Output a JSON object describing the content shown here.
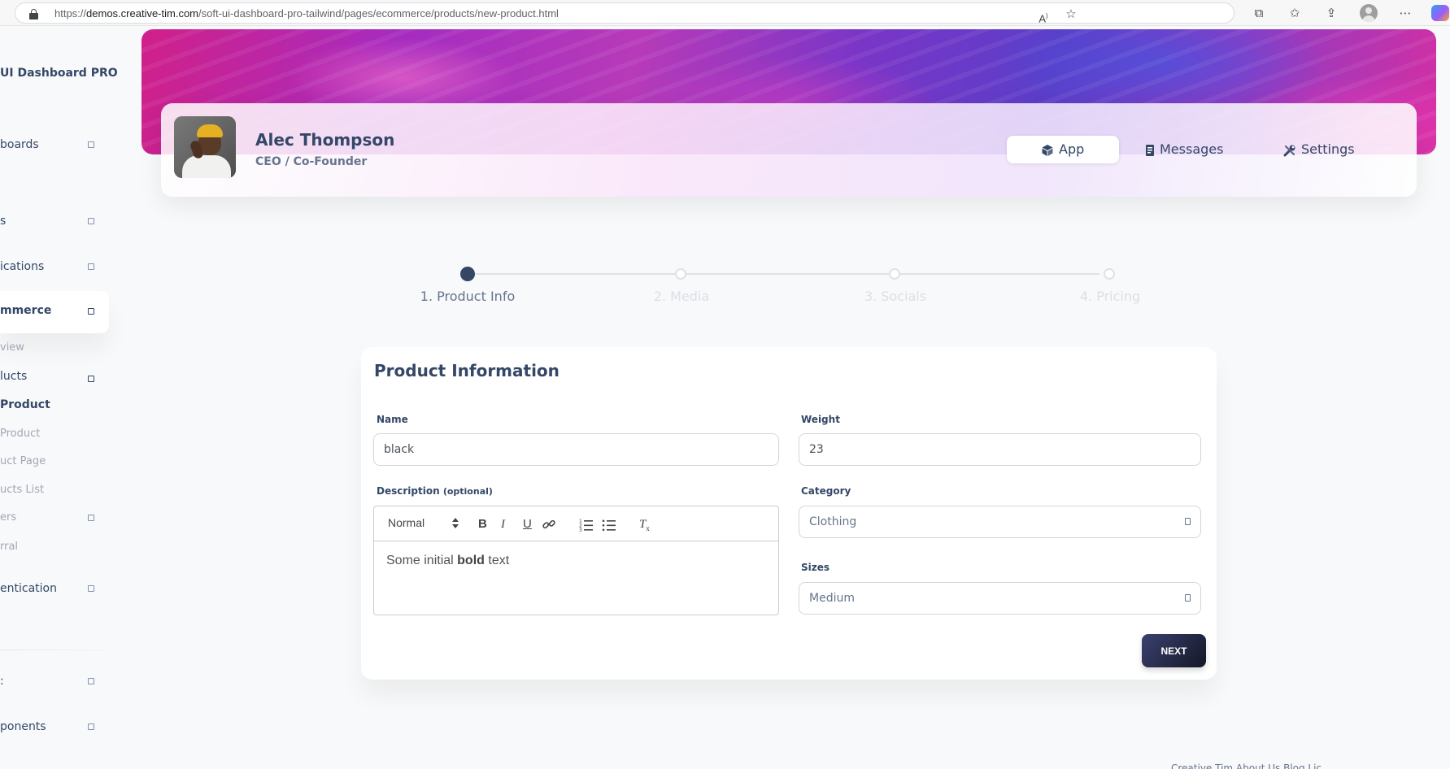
{
  "browser": {
    "url_prefix": "https://",
    "url_host": "demos.creative-tim.com",
    "url_path": "/soft-ui-dashboard-pro-tailwind/pages/ecommerce/products/new-product.html",
    "icons": [
      "read-aloud-icon",
      "favorite-star-icon",
      "extensions-icon",
      "favorites-icon",
      "share-icon",
      "profile-icon",
      "more-icon",
      "copilot-icon"
    ]
  },
  "sidebar": {
    "brand": "UI Dashboard PRO",
    "items": [
      {
        "label": "boards"
      },
      {
        "label": "s"
      },
      {
        "label": "ications"
      },
      {
        "label": "mmerce"
      }
    ],
    "sub_items": [
      {
        "label": "view"
      },
      {
        "label": "lucts"
      },
      {
        "label": "Product"
      },
      {
        "label": "Product"
      },
      {
        "label": "uct Page"
      },
      {
        "label": "ucts List"
      },
      {
        "label": "ers"
      },
      {
        "label": "rral"
      }
    ],
    "bottom_items": [
      {
        "label": "entication"
      },
      {
        "label": ":"
      },
      {
        "label": "ponents"
      }
    ]
  },
  "profile": {
    "name": "Alec Thompson",
    "role": "CEO / Co-Founder",
    "tabs": [
      {
        "label": "App",
        "icon": "cube-icon",
        "active": true
      },
      {
        "label": "Messages",
        "icon": "document-icon",
        "active": false
      },
      {
        "label": "Settings",
        "icon": "tools-icon",
        "active": false
      }
    ]
  },
  "stepper": {
    "steps": [
      {
        "label": "1. Product Info",
        "active": true
      },
      {
        "label": "2. Media",
        "active": false
      },
      {
        "label": "3. Socials",
        "active": false
      },
      {
        "label": "4. Pricing",
        "active": false
      }
    ]
  },
  "form": {
    "title": "Product Information",
    "name_label": "Name",
    "name_value": "black",
    "weight_label": "Weight",
    "weight_value": "23",
    "description_label": "Description",
    "description_optional": "(optional)",
    "editor": {
      "format": "Normal",
      "text_before": "Some initial ",
      "text_bold": "bold",
      "text_after": " text"
    },
    "category_label": "Category",
    "category_value": "Clothing",
    "sizes_label": "Sizes",
    "sizes_value": "Medium",
    "next_label": "NEXT"
  },
  "footer": {
    "links": "Creative Tim     About Us     Blog     Lic"
  }
}
